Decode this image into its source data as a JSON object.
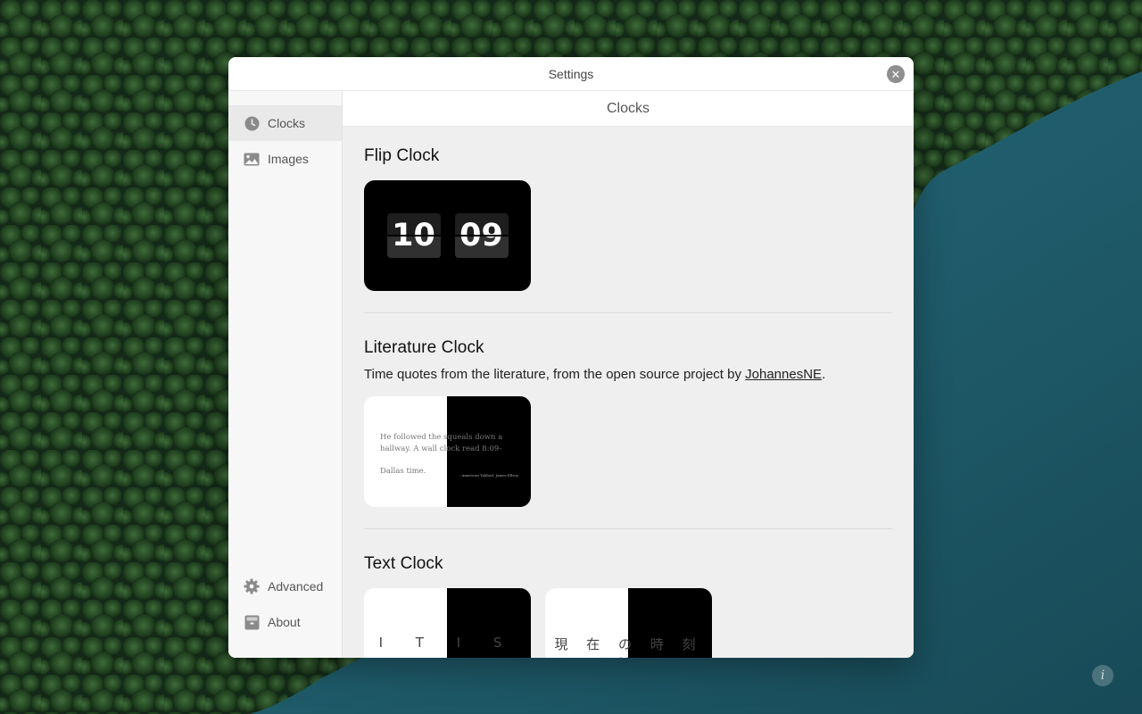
{
  "window": {
    "title": "Settings",
    "close_icon": "close-icon"
  },
  "sidebar": {
    "items": [
      {
        "label": "Clocks",
        "icon": "clock-icon",
        "active": true
      },
      {
        "label": "Images",
        "icon": "image-icon",
        "active": false
      }
    ],
    "bottom_items": [
      {
        "label": "Advanced",
        "icon": "gear-icon"
      },
      {
        "label": "About",
        "icon": "box-icon"
      }
    ]
  },
  "main": {
    "header": "Clocks",
    "sections": {
      "flip": {
        "title": "Flip Clock",
        "hours": "10",
        "minutes": "09"
      },
      "literature": {
        "title": "Literature Clock",
        "desc_before": "Time quotes from the literature, from the open source project by ",
        "desc_link": "JohannesNE",
        "desc_after": ".",
        "quote_text": "He followed the squeals down a hallway. A wall clock read 8:09-",
        "quote_time": "10:09",
        "quote_end": "Dallas time.",
        "citation": "- American Tabloid, James Ellroy"
      },
      "text": {
        "title": "Text Clock",
        "thumb1_letters": "I T I S",
        "thumb2_letters": "現 在 の 時 刻 は"
      }
    }
  },
  "info_icon": "info-icon",
  "colors": {
    "window_bg": "#ffffff",
    "content_bg": "#efefef",
    "sidebar_bg": "#f7f7f7",
    "active_item_bg": "#e9e9e9",
    "lake": "#1d4d5a",
    "forest": "#1a3320"
  }
}
